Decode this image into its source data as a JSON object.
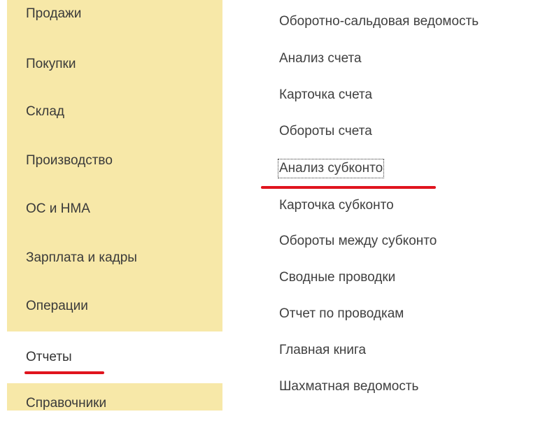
{
  "sidebar": {
    "items": [
      {
        "label": "Продажи"
      },
      {
        "label": "Покупки"
      },
      {
        "label": "Склад"
      },
      {
        "label": "Производство"
      },
      {
        "label": "ОС и НМА"
      },
      {
        "label": "Зарплата и кадры"
      },
      {
        "label": "Операции"
      },
      {
        "label": "Отчеты",
        "active": true
      },
      {
        "label": "Справочники"
      }
    ]
  },
  "reports": {
    "items": [
      {
        "label": "Оборотно-сальдовая ведомость"
      },
      {
        "label": "Анализ счета"
      },
      {
        "label": "Карточка счета"
      },
      {
        "label": "Обороты счета"
      },
      {
        "label": "Анализ субконто",
        "focused": true
      },
      {
        "label": "Карточка субконто"
      },
      {
        "label": "Обороты между субконто"
      },
      {
        "label": "Сводные проводки"
      },
      {
        "label": "Отчет по проводкам"
      },
      {
        "label": "Главная книга"
      },
      {
        "label": "Шахматная ведомость"
      }
    ]
  },
  "colors": {
    "sidebar_bg": "#f7e8a8",
    "highlight_underline": "#e0141e"
  }
}
